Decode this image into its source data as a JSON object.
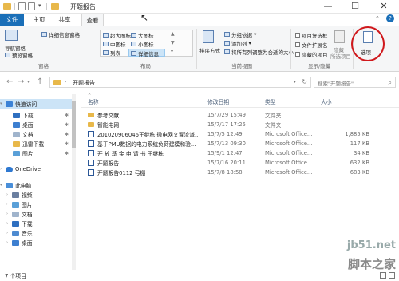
{
  "window": {
    "title": "开题报告",
    "controls": [
      "—",
      "☐",
      "✕"
    ]
  },
  "ribbon_tabs": [
    "文件",
    "主页",
    "共享",
    "查看"
  ],
  "ribbon": {
    "panes": {
      "nav_pane": "导航窗格",
      "preview": "预览窗格",
      "details": "详细信息窗格",
      "label": "窗格"
    },
    "layout": {
      "items": [
        "超大图标",
        "大图标",
        "中图标",
        "小图标",
        "列表",
        "详细信息"
      ],
      "label": "布局"
    },
    "current_view": {
      "sort": "排序方式",
      "group": "分组依据",
      "add_column": "添加列",
      "fit_columns": "将所有列调整为合适的大小",
      "label": "当前视图"
    },
    "show_hide": {
      "item_checkbox": "项目复选框",
      "extensions": "文件扩展名",
      "hidden_items": "隐藏的项目",
      "hide_selected": "隐藏",
      "hide_selected2": "所选项目",
      "label": "显示/隐藏"
    },
    "options": "选项"
  },
  "address": {
    "path": "开题报告",
    "search_placeholder": "搜索\"开题报告\""
  },
  "nav_pane": {
    "items": [
      {
        "label": "快速访问",
        "icon": "star-icon"
      },
      {
        "label": "下载",
        "icon": "download-icon"
      },
      {
        "label": "桌面",
        "icon": "desktop-icon"
      },
      {
        "label": "文档",
        "icon": "document-icon"
      },
      {
        "label": "迅雷下载",
        "icon": "folder-icon"
      },
      {
        "label": "图片",
        "icon": "pictures-icon"
      },
      {
        "label": "OneDrive",
        "icon": "cloud-icon"
      },
      {
        "label": "此电脑",
        "icon": "computer-icon"
      },
      {
        "label": "视频",
        "icon": "video-icon"
      },
      {
        "label": "图片",
        "icon": "pictures-icon"
      },
      {
        "label": "文档",
        "icon": "document-icon"
      },
      {
        "label": "下载",
        "icon": "download-icon"
      },
      {
        "label": "音乐",
        "icon": "music-icon"
      },
      {
        "label": "桌面",
        "icon": "desktop-icon"
      }
    ]
  },
  "file_list": {
    "columns": [
      "名称",
      "修改日期",
      "类型",
      "大小"
    ],
    "rows": [
      {
        "name": "参考文献",
        "date": "15/7/29 15:49",
        "type": "文件夹",
        "size": "",
        "kind": "folder"
      },
      {
        "name": "智能电网",
        "date": "15/7/17 17:25",
        "type": "文件夹",
        "size": "",
        "kind": "folder"
      },
      {
        "name": "201020906046王继栋 微电网文置流派...",
        "date": "15/7/5 12:49",
        "type": "Microsoft Office...",
        "size": "1,885 KB",
        "kind": "doc"
      },
      {
        "name": "基于PMU数据的电力系统负荷建模和验...",
        "date": "15/7/13 09:30",
        "type": "Microsoft Office...",
        "size": "117 KB",
        "kind": "doc"
      },
      {
        "name": "开 放 基 金 申 请 书  王继栋",
        "date": "15/9/1 12:47",
        "type": "Microsoft Office...",
        "size": "34 KB",
        "kind": "doc"
      },
      {
        "name": "开题报告",
        "date": "15/7/16 20:11",
        "type": "Microsoft Office...",
        "size": "632 KB",
        "kind": "doc"
      },
      {
        "name": "开题报告0112 弓棚",
        "date": "15/7/8 18:58",
        "type": "Microsoft Office...",
        "size": "683 KB",
        "kind": "doc"
      }
    ]
  },
  "status": {
    "count": "7 个项目"
  },
  "watermark": {
    "url": "jb51.net",
    "cn": "脚本之家"
  },
  "colors": {
    "accent": "#1a6fb8",
    "selection": "#cce4f7",
    "folder": "#e8b84a",
    "annotation": "#d0181c"
  }
}
